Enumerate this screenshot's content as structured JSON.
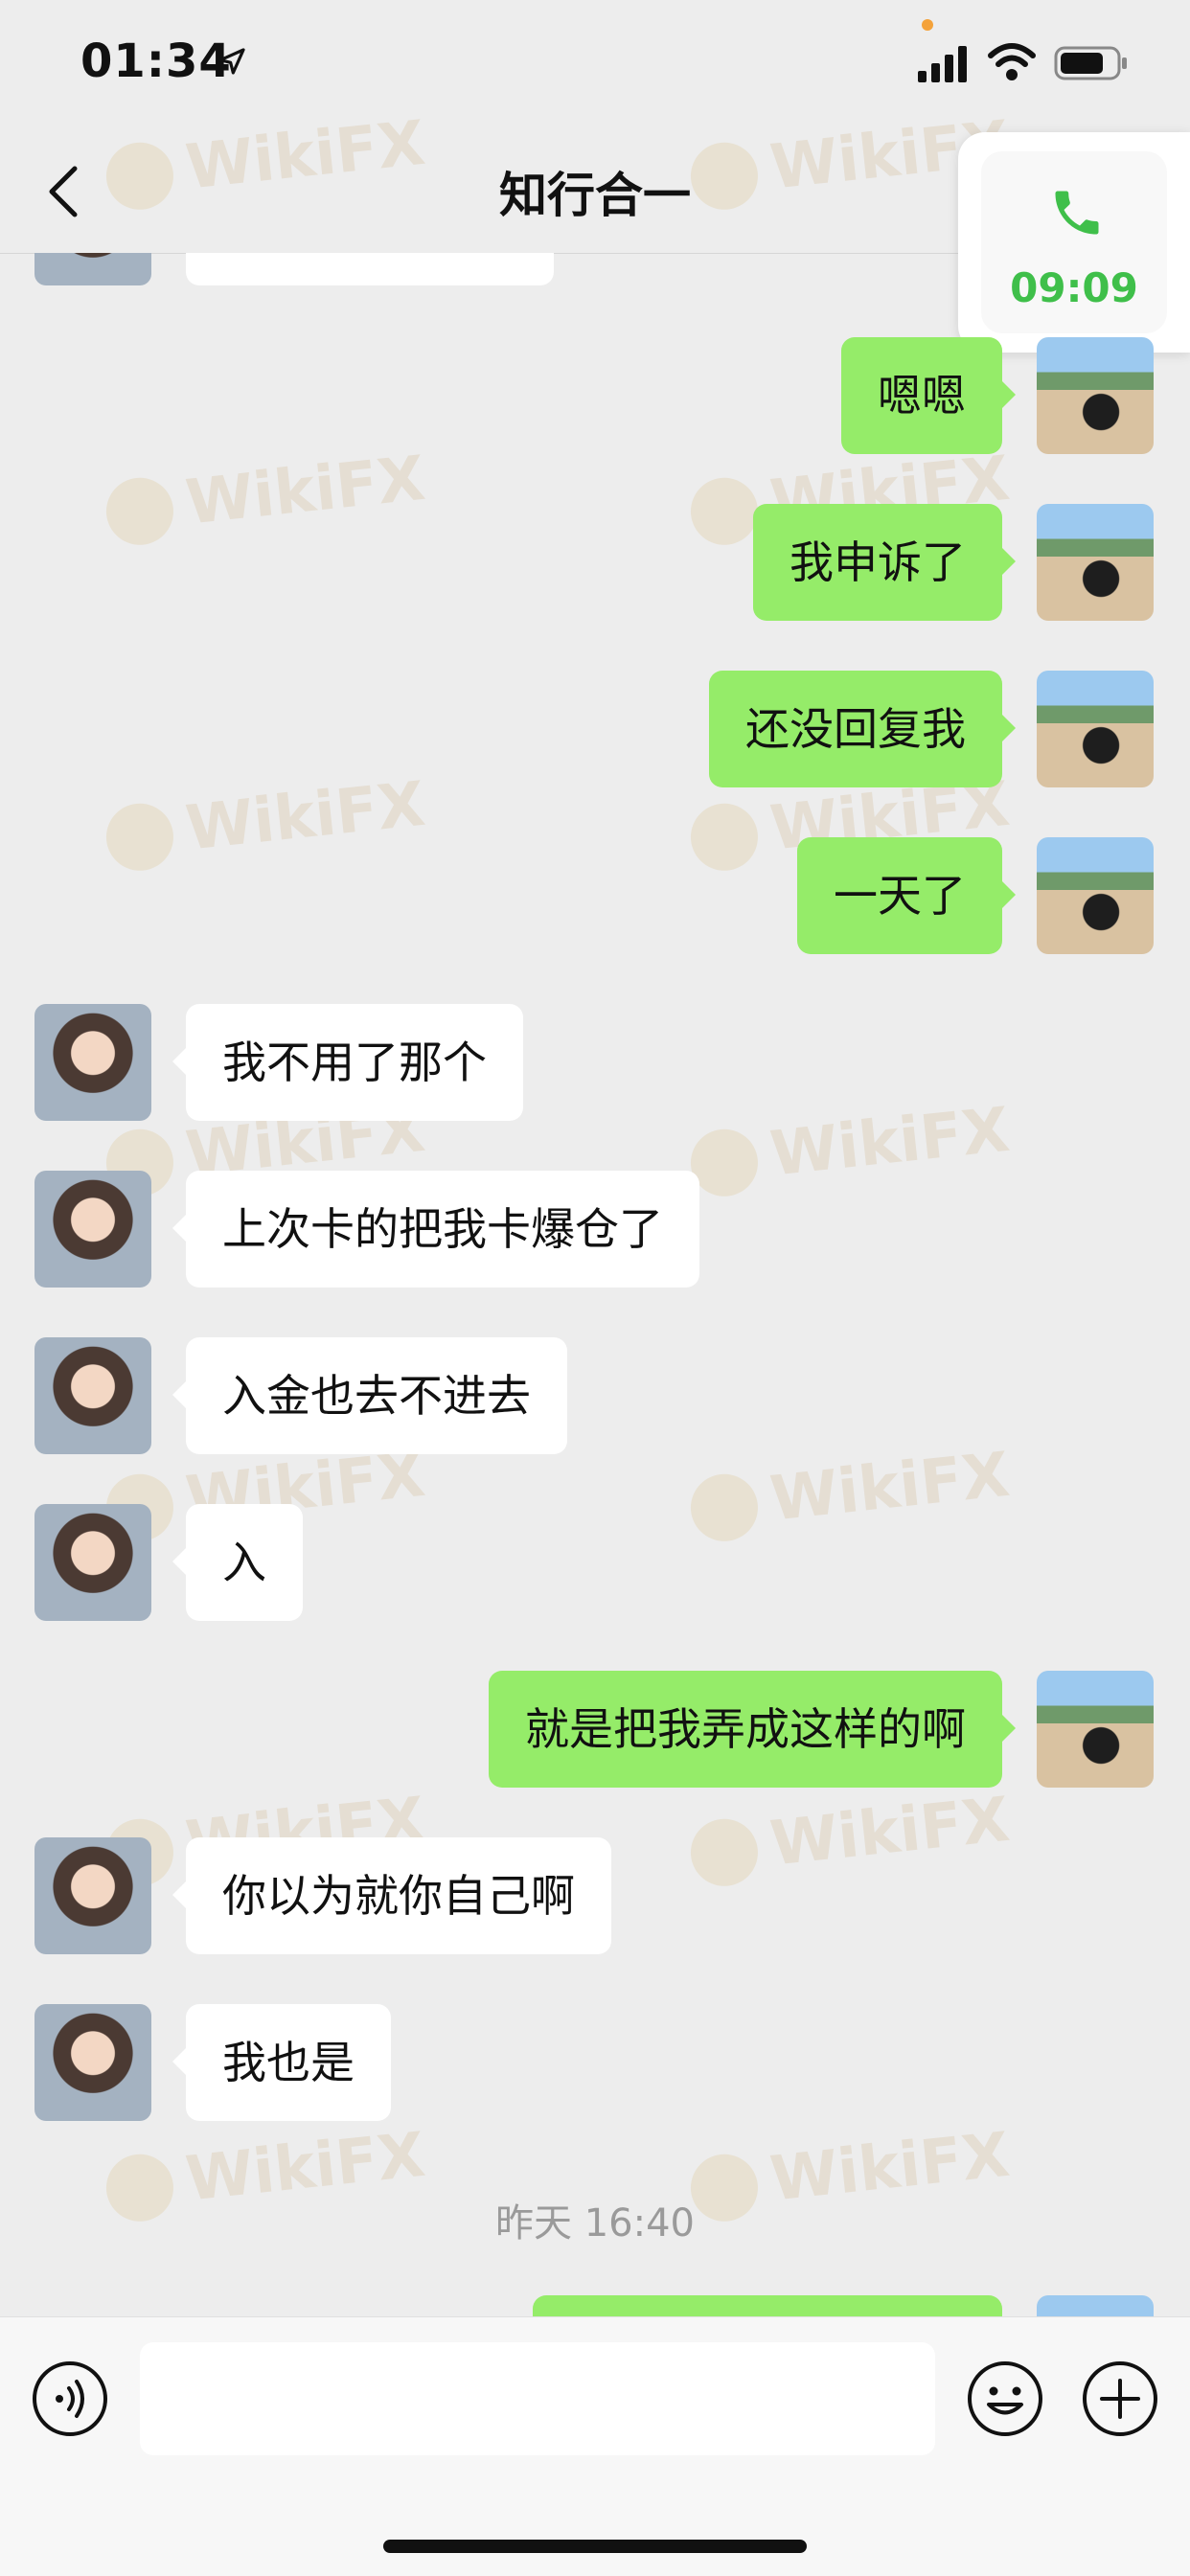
{
  "status_bar": {
    "time": "01:34",
    "location_icon": "location-arrow-icon",
    "signal_icon": "cellular-signal-icon",
    "wifi_icon": "wifi-icon",
    "battery_icon": "battery-icon"
  },
  "nav": {
    "title": "知行合一",
    "back_icon": "chevron-left-icon"
  },
  "call": {
    "duration": "09:09",
    "icon": "phone-icon",
    "color": "#3fbf4a"
  },
  "messages": [
    {
      "side": "right",
      "text": "嗯嗯"
    },
    {
      "side": "right",
      "text": "我申诉了"
    },
    {
      "side": "right",
      "text": "还没回复我"
    },
    {
      "side": "right",
      "text": "一天了"
    },
    {
      "side": "left",
      "text": "我不用了那个"
    },
    {
      "side": "left",
      "text": "上次卡的把我卡爆仓了"
    },
    {
      "side": "left",
      "text": "入金也去不进去"
    },
    {
      "side": "left",
      "text": "入"
    },
    {
      "side": "right",
      "text": "就是把我弄成这样的啊"
    },
    {
      "side": "left",
      "text": "你以为就你自己啊"
    },
    {
      "side": "left",
      "text": "我也是"
    }
  ],
  "timestamp": "昨天 16:40",
  "input_bar": {
    "voice_icon": "voice-icon",
    "emoji_icon": "emoji-icon",
    "plus_icon": "plus-circle-icon",
    "input_value": ""
  },
  "colors": {
    "background": "#ededed",
    "sent_bubble": "#95ec69",
    "received_bubble": "#ffffff"
  },
  "watermark": "WikiFX"
}
